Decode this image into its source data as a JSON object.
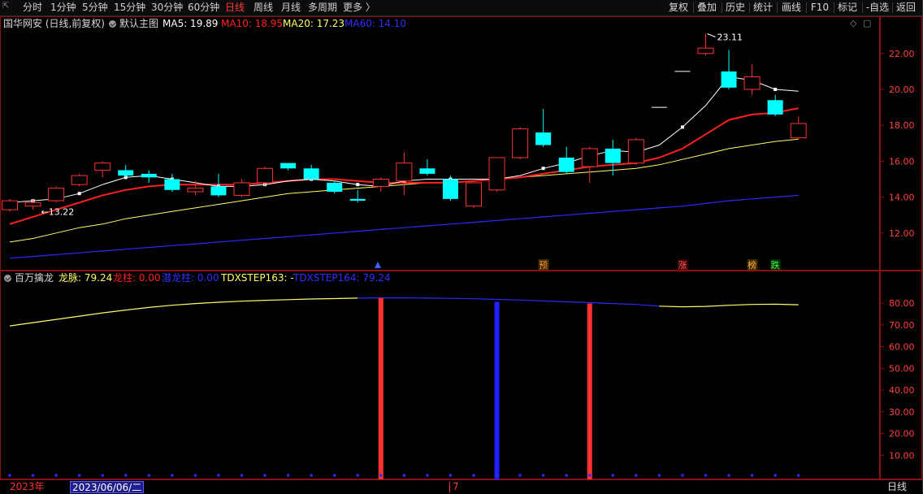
{
  "toolbar": {
    "periods": [
      "分时",
      "1分钟",
      "5分钟",
      "15分钟",
      "30分钟",
      "60分钟",
      "日线",
      "周线",
      "月线",
      "多周期",
      "更多 〉"
    ],
    "active_period": "日线",
    "right_buttons": [
      "复权",
      "叠加",
      "历史",
      "统计",
      "画线",
      "F10",
      "标记",
      "-自选",
      "返回"
    ]
  },
  "main_panel": {
    "stock_title": "国华网安 (日线,前复权)",
    "template_label": "默认主图",
    "ma5": "MA5: 19.89",
    "ma10": "MA10: 18.95",
    "ma20": "MA20: 17.23",
    "ma60": "MA60: 14.10",
    "high_label": "23.11",
    "low_label": "13.22",
    "y_ticks": [
      "22.00",
      "20.00",
      "18.00",
      "16.00",
      "14.00",
      "12.00"
    ],
    "signal_labels": [
      "预",
      "涨",
      "榜",
      "跌"
    ]
  },
  "indicator_panel": {
    "name": "百万擒龙",
    "longmai": "龙脉: 79.24",
    "longzhu": "龙柱: 0.00",
    "qianlongzhu": "潜龙柱: 0.00",
    "step163": "TDXSTEP163: -",
    "step164": "TDXSTEP164: 79.24",
    "y_ticks": [
      "80.00",
      "70.00",
      "60.00",
      "50.00",
      "40.00",
      "30.00",
      "20.00",
      "10.00"
    ]
  },
  "date_bar": {
    "year_label": "2023年",
    "cursor_date": "2023/06/06/二",
    "month_label": "7",
    "period_label": "日线"
  },
  "colors": {
    "up": "#ff3232",
    "down": "#00ffff",
    "ma5": "#ffffff",
    "ma10": "#ff2020",
    "ma20": "#ffff66",
    "ma60": "#2a2aff",
    "frame": "#8b1010"
  },
  "chart_data": {
    "type": "candlestick",
    "title": "国华网安 (日线,前复权)",
    "ylim": [
      10.5,
      23.8
    ],
    "candles": [
      {
        "o": 13.3,
        "h": 13.9,
        "l": 13.2,
        "c": 13.8
      },
      {
        "o": 13.5,
        "h": 13.9,
        "l": 13.3,
        "c": 13.7
      },
      {
        "o": 13.8,
        "h": 14.6,
        "l": 13.7,
        "c": 14.5
      },
      {
        "o": 14.7,
        "h": 15.3,
        "l": 14.6,
        "c": 15.2
      },
      {
        "o": 15.5,
        "h": 16.0,
        "l": 15.1,
        "c": 15.9
      },
      {
        "o": 15.5,
        "h": 15.8,
        "l": 15.1,
        "c": 15.2
      },
      {
        "o": 15.3,
        "h": 15.5,
        "l": 14.8,
        "c": 15.1
      },
      {
        "o": 15.0,
        "h": 15.3,
        "l": 14.3,
        "c": 14.4
      },
      {
        "o": 14.3,
        "h": 14.9,
        "l": 14.1,
        "c": 14.5
      },
      {
        "o": 14.6,
        "h": 15.3,
        "l": 14.0,
        "c": 14.1
      },
      {
        "o": 14.1,
        "h": 15.0,
        "l": 14.0,
        "c": 14.8
      },
      {
        "o": 14.8,
        "h": 15.7,
        "l": 14.6,
        "c": 15.6
      },
      {
        "o": 15.9,
        "h": 15.9,
        "l": 15.5,
        "c": 15.6
      },
      {
        "o": 15.6,
        "h": 15.8,
        "l": 14.9,
        "c": 15.0
      },
      {
        "o": 14.8,
        "h": 14.9,
        "l": 14.2,
        "c": 14.3
      },
      {
        "o": 13.9,
        "h": 14.4,
        "l": 13.7,
        "c": 13.8
      },
      {
        "o": 14.6,
        "h": 15.1,
        "l": 14.3,
        "c": 15.0
      },
      {
        "o": 14.9,
        "h": 16.5,
        "l": 14.1,
        "c": 15.9
      },
      {
        "o": 15.6,
        "h": 16.1,
        "l": 15.2,
        "c": 15.3
      },
      {
        "o": 15.0,
        "h": 15.2,
        "l": 13.8,
        "c": 13.9
      },
      {
        "o": 13.5,
        "h": 14.8,
        "l": 13.4,
        "c": 14.8
      },
      {
        "o": 14.4,
        "h": 16.2,
        "l": 14.3,
        "c": 16.2
      },
      {
        "o": 16.2,
        "h": 17.9,
        "l": 16.1,
        "c": 17.8
      },
      {
        "o": 17.6,
        "h": 18.9,
        "l": 16.8,
        "c": 16.9
      },
      {
        "o": 16.2,
        "h": 16.8,
        "l": 15.3,
        "c": 15.4
      },
      {
        "o": 15.7,
        "h": 16.8,
        "l": 14.8,
        "c": 16.7
      },
      {
        "o": 16.7,
        "h": 17.2,
        "l": 15.2,
        "c": 15.9
      },
      {
        "o": 15.9,
        "h": 17.3,
        "l": 15.8,
        "c": 17.2
      },
      {
        "o": 19.0,
        "h": 19.0,
        "l": 19.0,
        "c": 19.0
      },
      {
        "o": 21.0,
        "h": 21.0,
        "l": 21.0,
        "c": 21.0
      },
      {
        "o": 22.0,
        "h": 23.1,
        "l": 21.9,
        "c": 22.3
      },
      {
        "o": 21.0,
        "h": 22.2,
        "l": 20.0,
        "c": 20.1
      },
      {
        "o": 20.0,
        "h": 21.4,
        "l": 19.7,
        "c": 20.7
      },
      {
        "o": 19.4,
        "h": 19.7,
        "l": 18.5,
        "c": 18.6
      },
      {
        "o": 17.3,
        "h": 18.5,
        "l": 17.2,
        "c": 18.1
      }
    ],
    "ma5": [
      13.7,
      13.8,
      13.9,
      14.2,
      14.7,
      15.1,
      15.2,
      15.0,
      14.8,
      14.6,
      14.6,
      14.7,
      14.9,
      15.0,
      14.9,
      14.7,
      14.6,
      14.9,
      15.0,
      15.0,
      15.0,
      15.0,
      15.2,
      15.6,
      15.9,
      16.3,
      16.6,
      16.5,
      16.9,
      17.9,
      19.1,
      20.7,
      20.5,
      20.0,
      19.9
    ],
    "ma10": [
      12.5,
      12.9,
      13.3,
      13.7,
      14.1,
      14.4,
      14.6,
      14.7,
      14.7,
      14.7,
      14.7,
      14.8,
      14.9,
      15.0,
      15.0,
      14.9,
      14.8,
      14.8,
      14.8,
      14.8,
      14.9,
      15.0,
      15.1,
      15.3,
      15.5,
      15.7,
      15.8,
      15.9,
      16.2,
      16.7,
      17.5,
      18.3,
      18.6,
      18.7,
      18.95
    ],
    "ma20": [
      11.5,
      11.7,
      12.0,
      12.3,
      12.5,
      12.8,
      13.0,
      13.2,
      13.4,
      13.6,
      13.8,
      14.0,
      14.2,
      14.3,
      14.4,
      14.5,
      14.6,
      14.7,
      14.8,
      14.8,
      14.9,
      15.0,
      15.1,
      15.2,
      15.3,
      15.4,
      15.5,
      15.6,
      15.8,
      16.1,
      16.4,
      16.7,
      16.9,
      17.1,
      17.23
    ],
    "ma60": [
      10.6,
      10.7,
      10.8,
      10.9,
      11.0,
      11.1,
      11.2,
      11.3,
      11.4,
      11.5,
      11.6,
      11.7,
      11.8,
      11.9,
      12.0,
      12.1,
      12.2,
      12.3,
      12.4,
      12.5,
      12.6,
      12.7,
      12.8,
      12.9,
      13.0,
      13.1,
      13.2,
      13.3,
      13.4,
      13.5,
      13.65,
      13.8,
      13.9,
      14.0,
      14.1
    ],
    "indicator": {
      "ylim": [
        0,
        89
      ],
      "longmai": [
        69.5,
        71.0,
        72.5,
        74.0,
        75.5,
        76.8,
        78.0,
        79.0,
        79.8,
        80.4,
        80.9,
        81.3,
        81.6,
        81.9,
        82.1,
        82.3,
        82.4,
        82.4,
        82.3,
        82.2,
        82.0,
        81.7,
        81.4,
        81.0,
        80.6,
        80.2,
        79.8,
        79.4,
        78.6,
        78.3,
        78.5,
        79.0,
        79.4,
        79.5,
        79.24
      ],
      "longmai_blue_range": [
        15,
        28
      ],
      "red_bars": [
        {
          "index": 16,
          "value": 82.4
        },
        {
          "index": 25,
          "value": 79.8
        }
      ],
      "blue_bars": [
        {
          "index": 21,
          "value": 80.6
        }
      ]
    }
  }
}
